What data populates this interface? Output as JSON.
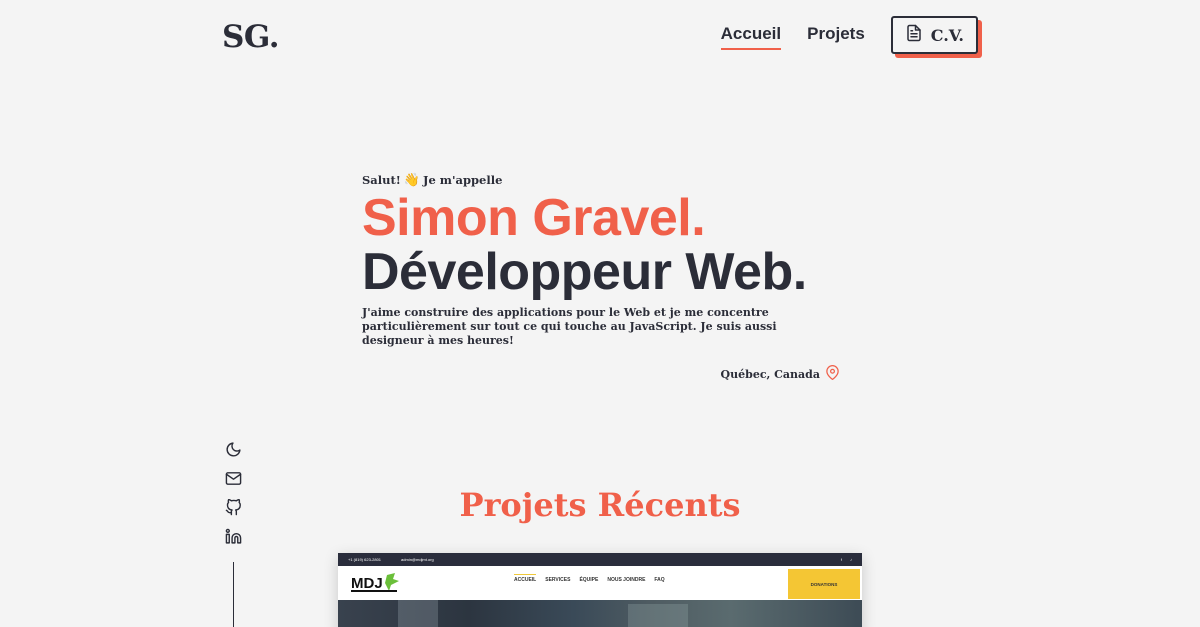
{
  "brand": {
    "logo": "SG."
  },
  "nav": {
    "items": [
      {
        "label": "Accueil",
        "active": true
      },
      {
        "label": "Projets",
        "active": false
      }
    ],
    "cv_label": "C.V."
  },
  "hero": {
    "greeting_before": "Salut!",
    "greeting_emoji": "👋",
    "greeting_after": "Je m'appelle",
    "name": "Simon Gravel.",
    "role": "Développeur Web.",
    "bio": "J'aime construire des applications pour le Web et je me concentre particulièrement sur tout ce qui touche au JavaScript. Je suis aussi designeur à mes heures!",
    "location": "Québec, Canada"
  },
  "social": [
    "moon-icon",
    "mail-icon",
    "github-icon",
    "linkedin-icon"
  ],
  "projects": {
    "title": "Projets Récents",
    "preview": {
      "phone": "+1 (819) 623-2801",
      "email": "admin@mdjmt.org",
      "logo_text": "MDJ",
      "nav": [
        "ACCUEIL",
        "SERVICES",
        "ÉQUIPE",
        "NOUS JOINDRE",
        "FAQ"
      ],
      "donate": "DONATIONS"
    }
  },
  "colors": {
    "accent": "#f0604a",
    "dark": "#2b2d38",
    "background": "#f4f4f4"
  }
}
